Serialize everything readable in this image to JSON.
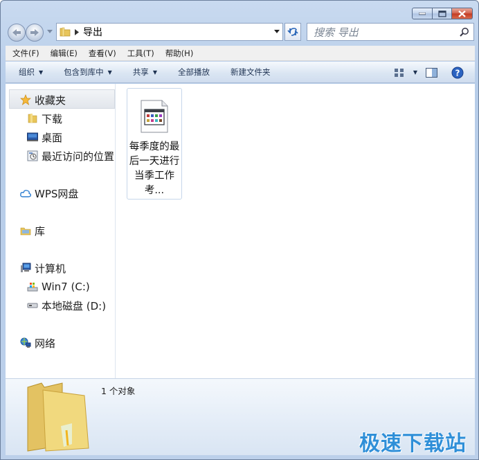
{
  "window": {
    "caption_buttons": [
      "minimize",
      "maximize",
      "close"
    ]
  },
  "address_bar": {
    "crumb": "导出"
  },
  "search": {
    "placeholder": "搜索 导出"
  },
  "menubar": {
    "items": [
      "文件(F)",
      "编辑(E)",
      "查看(V)",
      "工具(T)",
      "帮助(H)"
    ]
  },
  "cmdbar": {
    "organize": "组织",
    "include_library": "包含到库中",
    "share": "共享",
    "play_all": "全部播放",
    "new_folder": "新建文件夹"
  },
  "nav_pane": {
    "favorites": "收藏夹",
    "downloads": "下载",
    "desktop": "桌面",
    "recent": "最近访问的位置",
    "wps": "WPS网盘",
    "library": "库",
    "computer": "计算机",
    "drive_c": "Win7 (C:)",
    "drive_d": "本地磁盘 (D:)",
    "network": "网络"
  },
  "files": [
    {
      "name": "每季度的最后一天进行当季工作考..."
    }
  ],
  "details": {
    "count": "1 个对象"
  },
  "watermark": "极速下载站",
  "colors": {
    "accent": "#2f8fd8",
    "window_frame": "#b7cde9",
    "close_button": "#c33a22"
  }
}
